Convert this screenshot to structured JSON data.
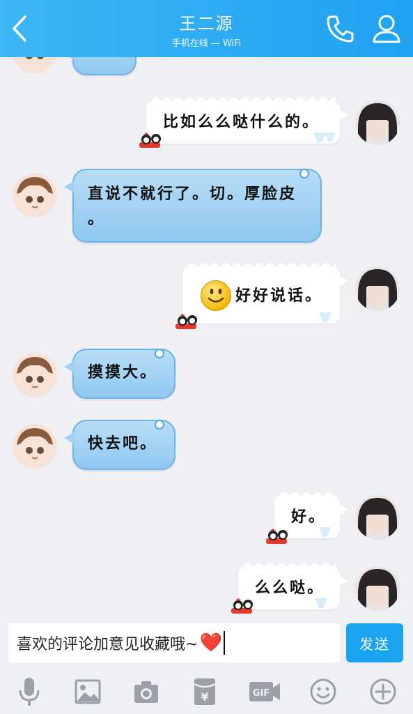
{
  "header": {
    "contact_name": "王二源",
    "status": "手机在线 — WiFi"
  },
  "messages": [
    {
      "side": "left",
      "text": ""
    },
    {
      "side": "right",
      "text": "比如么么哒什么的。"
    },
    {
      "side": "left",
      "text_line1": "直说不就行了。切。厚脸皮",
      "text_line2": "。"
    },
    {
      "side": "right",
      "text": "好好说话。",
      "emoji": "smiley-emoji"
    },
    {
      "side": "left",
      "text": "摸摸大。"
    },
    {
      "side": "left",
      "text": "快去吧。"
    },
    {
      "side": "right",
      "text": "好。"
    },
    {
      "side": "right",
      "text": "么么哒。"
    }
  ],
  "input": {
    "value": "喜欢的评论加意见收藏哦~",
    "emoji": "❤️"
  },
  "send_label": "发送",
  "toolbar": {
    "icons": [
      "microphone-icon",
      "image-icon",
      "camera-icon",
      "red-packet-icon",
      "gif-icon",
      "emoji-icon",
      "plus-icon"
    ]
  },
  "colors": {
    "header": "#1fa2f2",
    "send": "#1aa3f0",
    "bubble_left": "#9fd0f3",
    "bubble_right": "#ffffff",
    "background": "#eef0f4"
  }
}
